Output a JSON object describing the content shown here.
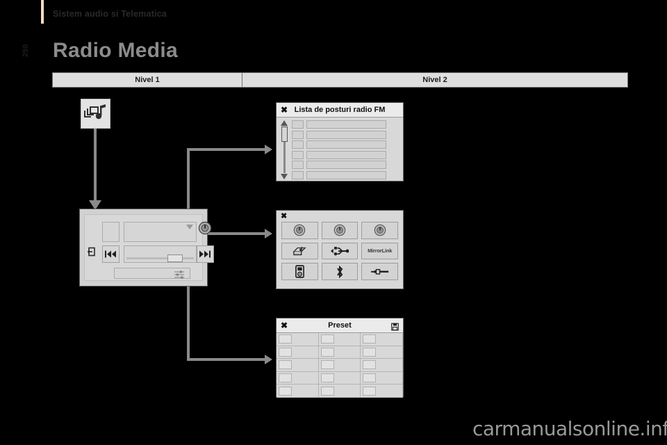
{
  "header": {
    "section_title": "Sistem audio si Telematica",
    "page_number": "250",
    "accent_color": "#f6ddc4"
  },
  "document": {
    "title": "Radio Media",
    "title_color": "#8c8c8c"
  },
  "levels_table": {
    "columns": [
      "Nivel 1",
      "Nivel 2"
    ]
  },
  "diagram": {
    "source_icon": {
      "name": "media-music-icon",
      "label": ""
    },
    "radio_list_panel": {
      "close_label": "✖",
      "title": "Lista de posturi radio FM",
      "scroll_up_icon": "triangle-up-icon",
      "scroll_down_icon": "triangle-down-icon",
      "row_count": 6
    },
    "source_panel": {
      "close_label": "✖",
      "items": [
        {
          "name": "radio-tuner-1-icon",
          "label": ""
        },
        {
          "name": "radio-tuner-2-icon",
          "label": ""
        },
        {
          "name": "radio-tuner-3-icon",
          "label": ""
        },
        {
          "name": "cd-media-icon",
          "label": ""
        },
        {
          "name": "usb-icon",
          "label": ""
        },
        {
          "name": "mirrorlink-icon",
          "label": "MirrorLink"
        },
        {
          "name": "ipod-icon",
          "label": ""
        },
        {
          "name": "bluetooth-icon",
          "label": ""
        },
        {
          "name": "aux-jack-icon",
          "label": ""
        }
      ]
    },
    "preset_panel": {
      "close_label": "✖",
      "title": "Preset",
      "save_icon": "floppy-save-icon",
      "rows": 5,
      "columns": 3
    },
    "player_panel": {
      "exit_icon": "exit-icon",
      "previous_icon": "previous-track-icon",
      "next_icon": "next-track-icon",
      "knob_icon": "source-knob-icon",
      "equalizer_icon": "equalizer-icon",
      "dropdown_icon": "chevron-down-icon"
    },
    "connector_color": "#8a8a8a"
  },
  "watermark": {
    "text": "carmanualsonline.info"
  }
}
